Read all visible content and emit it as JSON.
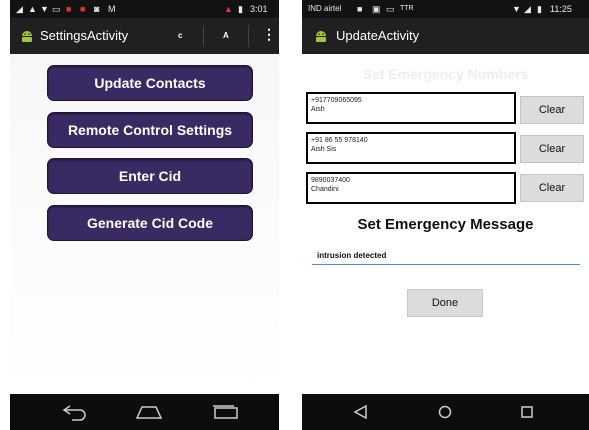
{
  "left": {
    "status_bar": {
      "time": "3:01"
    },
    "app_bar": {
      "title": "SettingsActivity",
      "action_c": "c",
      "action_a": "A",
      "overflow": "⋮"
    },
    "buttons": {
      "update_contacts": "Update Contacts",
      "remote_control_settings": "Remote Control Settings",
      "enter_cid": "Enter Cid",
      "generate_cid_code": "Generate Cid Code"
    },
    "colors": {
      "button_bg": "#3a2a63",
      "button_text": "#ffffff"
    }
  },
  "right": {
    "status_bar": {
      "carrier": "IND airtel",
      "network": "TTR",
      "time": "11:25"
    },
    "app_bar": {
      "title": "UpdateActivity"
    },
    "section_heading": "Set Emergency Numbers",
    "contacts": [
      {
        "number": "+917709065095",
        "name": "Aish",
        "clear_label": "Clear"
      },
      {
        "number": "+91 86 55 978140",
        "name": "Aish Sis",
        "clear_label": "Clear"
      },
      {
        "number": "9890037400",
        "name": "Chandini",
        "clear_label": "Clear"
      }
    ],
    "message_heading": "Set Emergency Message",
    "message_value": "intrusion detected",
    "done_label": "Done",
    "colors": {
      "input_underline": "#4a90d9"
    }
  },
  "icons": {
    "app_icon": "android-icon",
    "nav_back": "back-icon",
    "nav_home": "home-icon",
    "nav_recents": "recents-icon"
  }
}
